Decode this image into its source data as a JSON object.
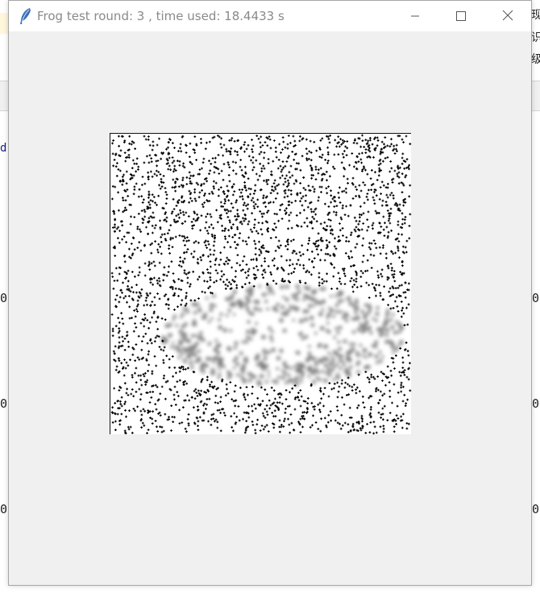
{
  "window": {
    "title": "Frog test round: 3 , time used: 18.4433 s",
    "icon": "feather-icon",
    "controls": {
      "minimize_icon": "minimize-icon",
      "maximize_icon": "maximize-icon",
      "close_icon": "close-icon"
    }
  },
  "canvas": {
    "description_colors": {
      "background": "#ffffff",
      "dots": "#000000",
      "blur": "#7a7a7a"
    }
  },
  "background_app": {
    "left_letter": "d",
    "right_glyphs": [
      "现",
      "识",
      "级"
    ],
    "zeros": [
      "0",
      "0",
      "0",
      "0",
      "0",
      "0"
    ]
  }
}
